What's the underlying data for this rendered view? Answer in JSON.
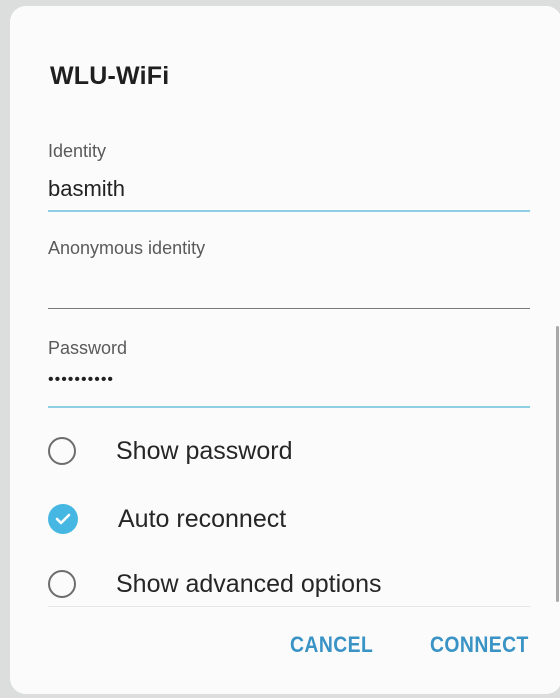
{
  "dialog": {
    "title": "WLU-WiFi"
  },
  "form": {
    "identity": {
      "label": "Identity",
      "value": "basmith"
    },
    "anonymous_identity": {
      "label": "Anonymous identity",
      "value": ""
    },
    "password": {
      "label": "Password",
      "value": "••••••••••"
    }
  },
  "options": {
    "show_password": {
      "label": "Show password",
      "checked": false
    },
    "auto_reconnect": {
      "label": "Auto reconnect",
      "checked": true
    },
    "show_advanced": {
      "label": "Show advanced options",
      "checked": false
    }
  },
  "actions": {
    "cancel": "CANCEL",
    "connect": "CONNECT"
  },
  "colors": {
    "accent": "#46b7e3",
    "button_text": "#3a93c5",
    "clipped_text": "#e05a4e"
  }
}
